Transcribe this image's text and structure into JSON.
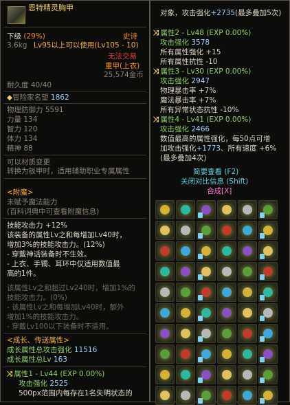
{
  "left": {
    "item_name": "恩特精灵胸甲",
    "grade": "下级",
    "grade_pct": "(29%)",
    "rarity": "史诗",
    "weight": "3.6kg",
    "level_req": "Lv95以上可以使用(Lv105 - 10)",
    "trade_status": "无法交易",
    "slot_type": "重甲(上衣)",
    "price": "25,574金币",
    "durability": "耐久度 40/40",
    "fame_label": "冒险家名望",
    "fame_value": "1862",
    "stats": [
      {
        "label": "物理防御力",
        "value": "5591"
      },
      {
        "label": "力量",
        "value": "134"
      },
      {
        "label": "智力",
        "value": "120"
      },
      {
        "label": "体力",
        "value": "134"
      },
      {
        "label": "精神",
        "value": "88"
      }
    ],
    "convert_1": "可以材质变更",
    "convert_2": "转换为板甲时，适用辅助职业专属属性",
    "enchant_header": "<附魔>",
    "enchant_1": "未赋予魔法能力",
    "enchant_2": "(百科词典中可查看附魔信息)",
    "skill_1": "技能攻击力 +12%",
    "skill_2": "该装备的属性Lv之和每增加Lv40时，",
    "skill_3": "增加3%的技能攻击力。(12%)",
    "skill_4": "- 穿戴神话装备时不生效。",
    "skill_5": "- 上衣、手镯、耳环中仅适用数值最",
    "skill_6": "高的1件。",
    "inactive_1": "该属性Lv之和超过Lv240时，增加1%的",
    "inactive_2": "技能攻击力。(0%)",
    "inactive_3": "- 该属性Lv之和每增加Lv40时，额外",
    "inactive_4": "增加1%的技能攻击力。",
    "inactive_5": "- 穿戴Lv100以下装备时不适用。",
    "growth_header": "<成长、传送属性>",
    "growth_atk_label": "成长属性总攻击强化",
    "growth_atk_value": "11516",
    "growth_lv_label": "成长属性总Lv",
    "growth_lv_value": "163",
    "attr1_title": "属性1 - Lv44 (EXP 0.00%)",
    "attr1_atk_label": "攻击强化",
    "attr1_atk_value": "2525",
    "attr1_desc": "500px范围内每存在1名失明状态的"
  },
  "right": {
    "line_target": "对象，攻击强化",
    "line_target_val": "+2735",
    "line_target_tail": "(最多叠加5次)",
    "attr2_title": "属性2 - Lv48 (EXP 0.00%)",
    "attr2_atk_label": "攻击强化",
    "attr2_atk_value": "3578",
    "attr2_l1": "所有属性强化 +15",
    "attr2_l2": "所有属性抗性 -10",
    "attr3_title": "属性3 - Lv30 (EXP 0.00%)",
    "attr3_atk_label": "攻击强化",
    "attr3_atk_value": "2947",
    "attr3_l1": "物理暴击率 +7%",
    "attr3_l2": "魔法暴击率 +7%",
    "attr3_l3": "所有异常状态抗性 -10%",
    "attr4_title": "属性4 - Lv41 (EXP 0.00%)",
    "attr4_atk_label": "攻击强化",
    "attr4_atk_value": "2466",
    "attr4_l1": "数值最高的属性强化，每50点可增",
    "attr4_l2_a": "加攻击强化",
    "attr4_l2_b": "+1773",
    "attr4_l2_c": "、所有速度 +6%",
    "attr4_l3": "(最多叠加4次)",
    "btn_simple": "简要查看 (F2)",
    "btn_compare": "关闭对比信息 (Shift)",
    "btn_compose": "合成[X]"
  }
}
